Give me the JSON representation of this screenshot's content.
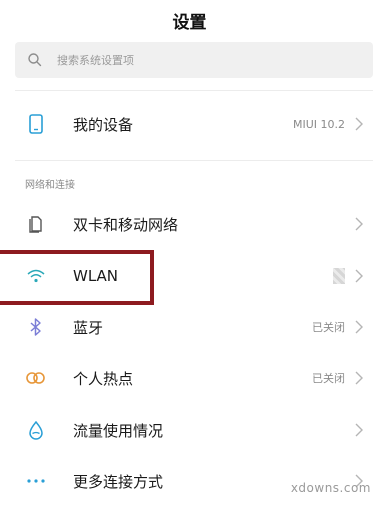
{
  "header": {
    "title": "设置"
  },
  "search": {
    "placeholder": "搜索系统设置项"
  },
  "device": {
    "label": "我的设备",
    "value": "MIUI 10.2"
  },
  "section": {
    "title": "网络和连接"
  },
  "items": [
    {
      "label": "双卡和移动网络",
      "value": "",
      "icon": "sim-card-icon"
    },
    {
      "label": "WLAN",
      "value": "",
      "icon": "wifi-icon"
    },
    {
      "label": "蓝牙",
      "value": "已关闭",
      "icon": "bluetooth-icon"
    },
    {
      "label": "个人热点",
      "value": "已关闭",
      "icon": "hotspot-icon"
    },
    {
      "label": "流量使用情况",
      "value": "",
      "icon": "data-usage-icon"
    },
    {
      "label": "更多连接方式",
      "value": "",
      "icon": "more-icon"
    }
  ],
  "watermark": "xdowns.com",
  "colors": {
    "highlight": "#8d1a1f",
    "accent": "#2a9fd6"
  }
}
